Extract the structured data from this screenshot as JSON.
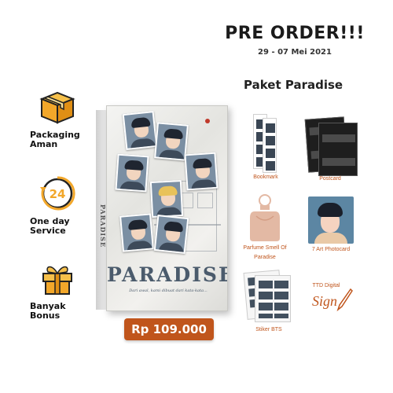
{
  "header": {
    "title": "PRE ORDER!!!",
    "date": "29 - 07 Mei 2021"
  },
  "features": [
    {
      "icon": "package-box-icon",
      "label": "Packaging Aman"
    },
    {
      "icon": "24-hour-service-icon",
      "label": "One day Service"
    },
    {
      "icon": "gift-box-icon",
      "label": "Banyak Bonus"
    }
  ],
  "book": {
    "title": "PARADISE",
    "spine_text": "PARADISE",
    "tagline": "Dari awal, kami dibuat dari kata-kata..."
  },
  "price": "Rp 109.000",
  "paket": {
    "title": "Paket Paradise",
    "items": [
      {
        "label": "Bookmark"
      },
      {
        "label": "Postcard"
      },
      {
        "label": "Parfume Smell Of Paradise"
      },
      {
        "label": "7 Art Photocard"
      },
      {
        "label": "TTD Digital"
      },
      {
        "label": "Stiker BTS"
      }
    ],
    "sign_text": "Sign"
  },
  "colors": {
    "accent": "#c0551c",
    "icon_orange": "#f2a72a",
    "book_title": "#4b5b6c"
  }
}
